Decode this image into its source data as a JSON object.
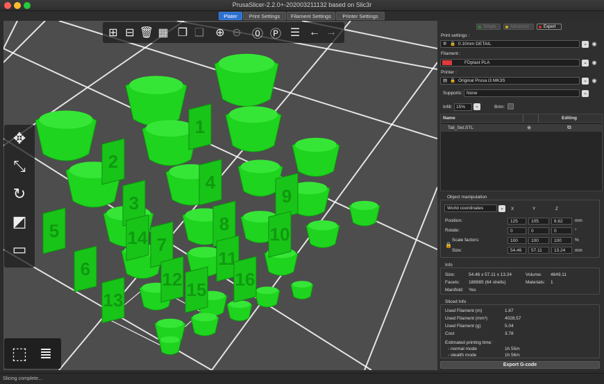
{
  "window": {
    "title": "PrusaSlicer-2.2.0+-202003211132 based on Slic3r"
  },
  "tabs": [
    {
      "label": "Plater",
      "active": true
    },
    {
      "label": "Print Settings",
      "active": false
    },
    {
      "label": "Filament Settings",
      "active": false
    },
    {
      "label": "Printer Settings",
      "active": false
    }
  ],
  "viewport": {
    "labels": [
      "1",
      "2",
      "3",
      "4",
      "5",
      "6",
      "7",
      "8",
      "9",
      "10",
      "11",
      "12",
      "13",
      "14",
      "15",
      "16"
    ]
  },
  "modes": {
    "simple": "Simple",
    "advanced": "Advanced",
    "expert": "Expert"
  },
  "settings": {
    "print_label": "Print settings :",
    "print_value": "0.10mm DETAIL",
    "filament_label": "Filament :",
    "filament_value": "FDplast PLA",
    "filament_color": "#e23a3a",
    "printer_label": "Printer :",
    "printer_value": "Original Prusa i3 MK3S",
    "supports_label": "Supports:",
    "supports_value": "None",
    "infill_label": "Infill:",
    "infill_value": "15%",
    "brim_label": "Brim:"
  },
  "object_list": {
    "col_name": "Name",
    "col_editing": "Editing",
    "items": [
      {
        "name": "Tail_Set.STL"
      }
    ]
  },
  "manip": {
    "title": "Object manipulation",
    "coords": "World coordinates",
    "x": "X",
    "y": "Y",
    "z": "Z",
    "position_label": "Position:",
    "position": [
      "125",
      "105",
      "6.62"
    ],
    "position_unit": "mm",
    "rotate_label": "Rotate:",
    "rotate": [
      "0",
      "0",
      "0"
    ],
    "rotate_unit": "°",
    "scale_label": "Scale factors:",
    "scale": [
      "100",
      "100",
      "100"
    ],
    "scale_unit": "%",
    "size_label": "Size:",
    "size": [
      "54.46",
      "57.11",
      "13.24"
    ],
    "size_unit": "mm"
  },
  "info": {
    "title": "Info",
    "size_label": "Size:",
    "size": "54.46 x 57.11 x 13.24",
    "volume_label": "Volume:",
    "volume": "4649.11",
    "facets_label": "Facets:",
    "facets": "188985 (64 shells)",
    "materials_label": "Materials:",
    "materials": "1",
    "manifold_label": "Manifold:",
    "manifold": "Yes"
  },
  "sliced": {
    "title": "Sliced Info",
    "filament_m_label": "Used Filament (m)",
    "filament_m": "1.67",
    "filament_mm3_label": "Used Filament (mm³)",
    "filament_mm3": "4028.57",
    "filament_g_label": "Used Filament (g)",
    "filament_g": "5.04",
    "cost_label": "Cost",
    "cost": "3.78",
    "time_label": "Estimated printing time:",
    "normal_label": "- normal mode",
    "normal": "1h 55m",
    "stealth_label": "- stealth mode",
    "stealth": "1h 56m"
  },
  "export_label": "Export G-code",
  "status": "Slicing complete..."
}
